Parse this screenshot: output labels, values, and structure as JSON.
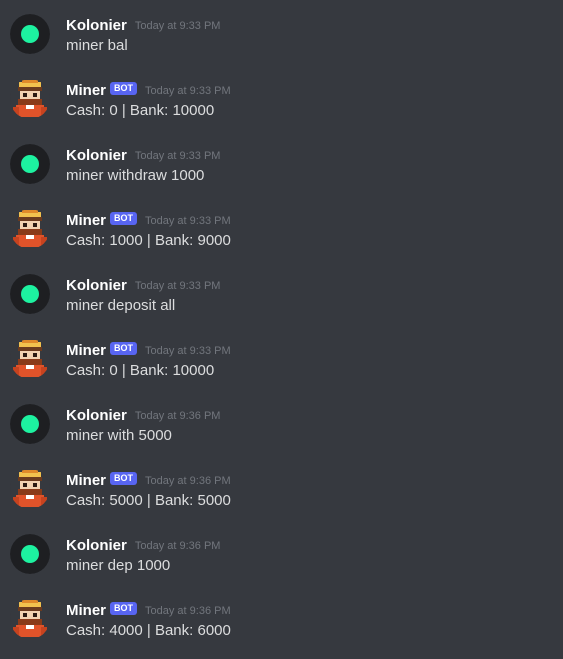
{
  "colors": {
    "background": "#36393f",
    "username": "#ffffff",
    "message_text": "#dcddde",
    "timestamp": "#72767d",
    "bot_tag": "#5865f2",
    "user_avatar_ring": "#1e1f22",
    "user_avatar_dot": "#1df2a0"
  },
  "messages": [
    {
      "author": "Kolonier",
      "bot": false,
      "time": "Today at 9:33 PM",
      "text": "miner bal",
      "avatar_icon": "green-dot-avatar-icon"
    },
    {
      "author": "Miner",
      "bot": true,
      "bot_label": "BOT",
      "time": "Today at 9:33 PM",
      "text": "Cash: 0 | Bank: 10000",
      "avatar_icon": "pixel-miner-avatar-icon"
    },
    {
      "author": "Kolonier",
      "bot": false,
      "time": "Today at 9:33 PM",
      "text": "miner withdraw 1000",
      "avatar_icon": "green-dot-avatar-icon"
    },
    {
      "author": "Miner",
      "bot": true,
      "bot_label": "BOT",
      "time": "Today at 9:33 PM",
      "text": "Cash: 1000 | Bank: 9000",
      "avatar_icon": "pixel-miner-avatar-icon"
    },
    {
      "author": "Kolonier",
      "bot": false,
      "time": "Today at 9:33 PM",
      "text": "miner deposit all",
      "avatar_icon": "green-dot-avatar-icon"
    },
    {
      "author": "Miner",
      "bot": true,
      "bot_label": "BOT",
      "time": "Today at 9:33 PM",
      "text": "Cash: 0 | Bank: 10000",
      "avatar_icon": "pixel-miner-avatar-icon"
    },
    {
      "author": "Kolonier",
      "bot": false,
      "time": "Today at 9:36 PM",
      "text": "miner with 5000",
      "avatar_icon": "green-dot-avatar-icon"
    },
    {
      "author": "Miner",
      "bot": true,
      "bot_label": "BOT",
      "time": "Today at 9:36 PM",
      "text": "Cash: 5000 | Bank: 5000",
      "avatar_icon": "pixel-miner-avatar-icon"
    },
    {
      "author": "Kolonier",
      "bot": false,
      "time": "Today at 9:36 PM",
      "text": "miner dep 1000",
      "avatar_icon": "green-dot-avatar-icon"
    },
    {
      "author": "Miner",
      "bot": true,
      "bot_label": "BOT",
      "time": "Today at 9:36 PM",
      "text": "Cash: 4000 | Bank: 6000",
      "avatar_icon": "pixel-miner-avatar-icon"
    }
  ]
}
